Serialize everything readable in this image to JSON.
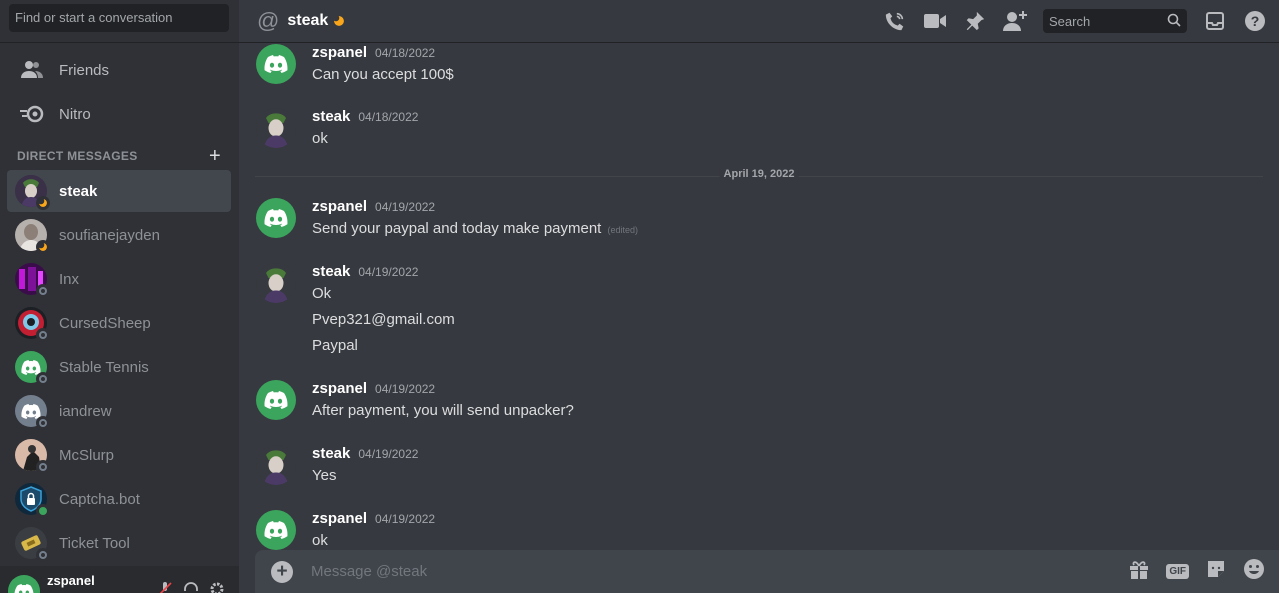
{
  "sidebar": {
    "search_placeholder": "Find or start a conversation",
    "nav": [
      {
        "label": "Friends",
        "icon": "friends-icon"
      },
      {
        "label": "Nitro",
        "icon": "nitro-icon"
      }
    ],
    "dm_header": "DIRECT MESSAGES",
    "dms": [
      {
        "name": "steak",
        "status": "idle",
        "active": true,
        "avatar": "joker-avatar"
      },
      {
        "name": "soufianejayden",
        "status": "idle",
        "avatar": "photo-avatar"
      },
      {
        "name": "Inx",
        "status": "offline",
        "avatar": "purple-avatar"
      },
      {
        "name": "CursedSheep",
        "status": "offline",
        "avatar": "sheep-avatar"
      },
      {
        "name": "Stable Tennis",
        "status": "offline",
        "avatar": "discord-green-avatar"
      },
      {
        "name": "iandrew",
        "status": "offline",
        "avatar": "discord-grey-avatar"
      },
      {
        "name": "McSlurp",
        "status": "offline",
        "avatar": "photo-avatar"
      },
      {
        "name": "Captcha.bot",
        "status": "online",
        "avatar": "shield-avatar"
      },
      {
        "name": "Ticket Tool",
        "status": "offline",
        "avatar": "ticket-avatar"
      }
    ],
    "user": {
      "name": "zspanel"
    }
  },
  "header": {
    "channel": "steak",
    "search_placeholder": "Search"
  },
  "messages": [
    {
      "author": "zspanel",
      "time": "04/18/2022",
      "lines": [
        "Can you accept 100$"
      ],
      "avatar": "discord-green-avatar"
    },
    {
      "author": "steak",
      "time": "04/18/2022",
      "lines": [
        "ok"
      ],
      "avatar": "joker-avatar"
    },
    {
      "author": "zspanel",
      "time": "04/19/2022",
      "lines": [
        "Send your paypal and today make payment"
      ],
      "edited": "(edited)",
      "avatar": "discord-green-avatar"
    },
    {
      "author": "steak",
      "time": "04/19/2022",
      "lines": [
        "Ok",
        "Pvep321@gmail.com",
        "Paypal"
      ],
      "avatar": "joker-avatar"
    },
    {
      "author": "zspanel",
      "time": "04/19/2022",
      "lines": [
        "After payment, you will send unpacker?"
      ],
      "avatar": "discord-green-avatar"
    },
    {
      "author": "steak",
      "time": "04/19/2022",
      "lines": [
        "Yes"
      ],
      "avatar": "joker-avatar"
    },
    {
      "author": "zspanel",
      "time": "04/19/2022",
      "lines": [
        "ok"
      ],
      "avatar": "discord-green-avatar"
    }
  ],
  "date_divider": "April 19, 2022",
  "composer": {
    "placeholder": "Message @steak",
    "gif_label": "GIF"
  },
  "colors": {
    "bg": "#36393f",
    "sidebar": "#2f3136",
    "accent_green": "#3ba55d",
    "idle": "#faa61a",
    "blurple": "#5865f2"
  }
}
